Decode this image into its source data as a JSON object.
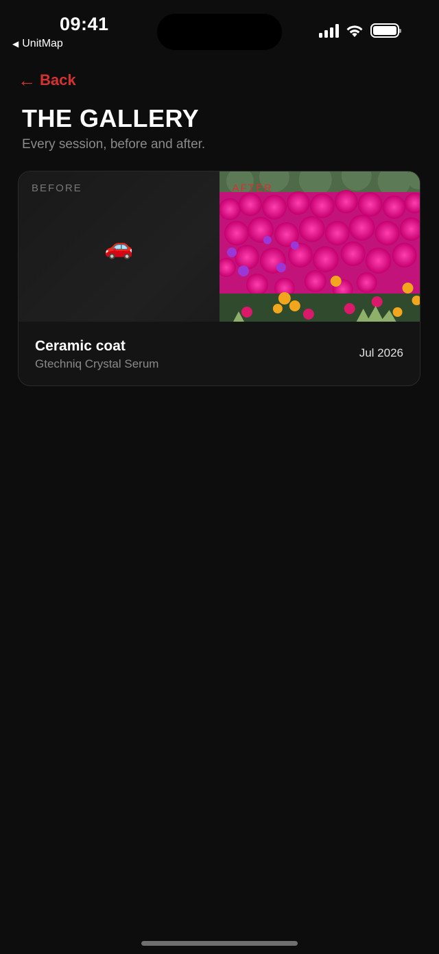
{
  "status_bar": {
    "time": "09:41",
    "back_app": "UnitMap",
    "back_app_icon": "back-triangle-icon"
  },
  "nav": {
    "back_label": "Back",
    "back_icon": "left-arrow-icon",
    "accent_color": "#d63131"
  },
  "header": {
    "title": "THE GALLERY",
    "subtitle": "Every session, before and after."
  },
  "gallery": {
    "items": [
      {
        "before_label": "BEFORE",
        "before_placeholder_icon": "🚗",
        "after_label": "AFTER",
        "title": "Ceramic coat",
        "subtitle": "Gtechniq Crystal Serum",
        "date": "Jul 2026"
      }
    ]
  }
}
